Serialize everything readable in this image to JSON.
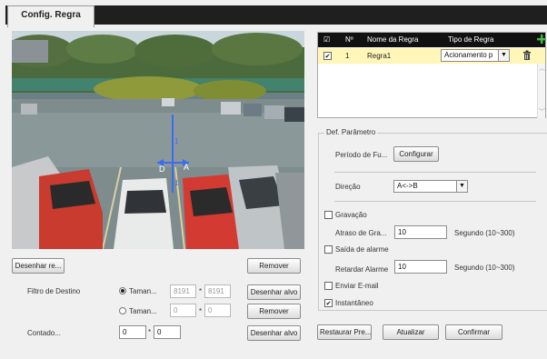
{
  "tab": {
    "label": "Config. Regra"
  },
  "camera": {
    "rule_label_left": "D",
    "rule_label_right": "A",
    "rule_label_top": "1",
    "rule_label_bottom": "1"
  },
  "left_panel": {
    "draw_rule_button": "Desenhar re...",
    "remove_button_1": "Remover",
    "target_filter_label": "Filtro de Destino",
    "size_max_label": "Taman...",
    "size_max_w": "8191",
    "size_max_h": "8191",
    "size_sep": "*",
    "draw_target_button_1": "Desenhar alvo",
    "size_min_label": "Taman...",
    "size_min_w": "0",
    "size_min_h": "0",
    "remove_button_2": "Remover",
    "counter_label": "Contado...",
    "counter_w": "0",
    "counter_h": "0",
    "draw_target_button_2": "Desenhar alvo"
  },
  "rule_table": {
    "headers": {
      "check": "☑",
      "number": "Nº",
      "name": "Nome da Regra",
      "type": "Tipo de Regra"
    },
    "add_icon": "add-icon",
    "rows": [
      {
        "number": "1",
        "name": "Regra1",
        "type": "Acionamento p",
        "delete_icon": "trash-icon"
      }
    ]
  },
  "params": {
    "legend": "Def. Parâmetro",
    "period_label": "Período de Fu...",
    "configure_button": "Configurar",
    "direction_label": "Direção",
    "direction_value": "A<->B",
    "recording_label": "Gravação",
    "recording_delay_label": "Atraso de Gra...",
    "recording_delay_value": "10",
    "recording_delay_unit": "Segundo (10~300)",
    "alarm_out_label": "Saída de alarme",
    "alarm_delay_label": "Retardar Alarme",
    "alarm_delay_value": "10",
    "alarm_delay_unit": "Segundo (10~300)",
    "email_label": "Enviar E-mail",
    "snapshot_label": "Instantâneo"
  },
  "bottom_buttons": {
    "restore": "Restaurar Pre...",
    "refresh": "Atualizar",
    "confirm": "Confirmar"
  },
  "colors": {
    "header_bg": "#111111",
    "selected_row": "#fff6b8",
    "rule_line": "#3b6cf0"
  }
}
